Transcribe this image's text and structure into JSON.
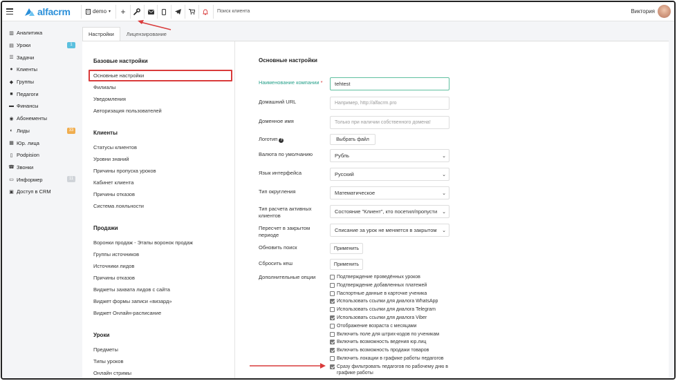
{
  "app": {
    "logo_text": "alfacrm",
    "branch": "demo",
    "search_placeholder": "Поиск клиента",
    "user_name": "Виктория"
  },
  "toolbar_icons": [
    "plus-icon",
    "wrench-icon",
    "mail-icon",
    "phone-icon",
    "telegram-icon",
    "cart-icon",
    "bell-icon"
  ],
  "sidebar": {
    "items": [
      {
        "label": "Аналитика",
        "icon": "analytics-icon"
      },
      {
        "label": "Уроки",
        "icon": "lessons-icon",
        "badge": "1",
        "badge_color": "#5bc0de"
      },
      {
        "label": "Задачи",
        "icon": "tasks-icon"
      },
      {
        "label": "Клиенты",
        "icon": "client-icon"
      },
      {
        "label": "Группы",
        "icon": "groups-icon"
      },
      {
        "label": "Педагоги",
        "icon": "teachers-icon"
      },
      {
        "label": "Финансы",
        "icon": "finance-icon"
      },
      {
        "label": "Абонементы",
        "icon": "subscriptions-icon"
      },
      {
        "label": "Лиды",
        "icon": "leads-icon",
        "badge": "33",
        "badge_color": "#f0ad4e"
      },
      {
        "label": "Юр. лица",
        "icon": "legal-icon"
      },
      {
        "label": "Podpision",
        "icon": "doc-icon"
      },
      {
        "label": "Звонки",
        "icon": "calls-icon"
      },
      {
        "label": "Информер",
        "icon": "informer-icon",
        "badge": "11",
        "badge_color": "#cfd3d8"
      },
      {
        "label": "Доступ в CRM",
        "icon": "lock-icon"
      }
    ]
  },
  "tabs": [
    {
      "label": "Настройки"
    },
    {
      "label": "Лицензирование"
    }
  ],
  "menu": {
    "sections": [
      {
        "title": "Базовые настройки",
        "links": [
          "Основные настройки",
          "Филиалы",
          "Уведомления",
          "Авторизация пользователей"
        ]
      },
      {
        "title": "Клиенты",
        "links": [
          "Статусы клиентов",
          "Уровни знаний",
          "Причины пропуска уроков",
          "Кабинет клиента",
          "Причины отказов",
          "Система лояльности"
        ]
      },
      {
        "title": "Продажи",
        "links": [
          "Воронки продаж - Этапы воронок продаж",
          "Группы источников",
          "Источники лидов",
          "Причины отказов",
          "Виджеты захвата лидов с сайта",
          "Виджет формы записи «визард»",
          "Виджет Онлайн-расписание"
        ]
      },
      {
        "title": "Уроки",
        "links": [
          "Предметы",
          "Типы уроков",
          "Онлайн стримы"
        ]
      }
    ]
  },
  "form": {
    "title": "Основные настройки",
    "company_label": "Наименование компании",
    "company_required": "*",
    "company_value": "tehtest",
    "home_url_label": "Домашний URL",
    "home_url_placeholder": "Например, http://alfacrm.pro",
    "domain_label": "Доменное имя",
    "domain_placeholder": "Только при наличии собственного домена!",
    "logo_label": "Логотип",
    "logo_button": "Выбрать файл",
    "currency_label": "Валюта по умолчанию",
    "currency_value": "Рубль",
    "lang_label": "Язык интерфейса",
    "lang_value": "Русский",
    "rounding_label": "Тип округления",
    "rounding_value": "Математическое",
    "active_label": "Тип расчета активных клиентов",
    "active_value": "Состояние \"Клиент\", кто посетил/пропусти",
    "recalc_label": "Пересчет в закрытом периоде",
    "recalc_value": "Списание за урок не меняется в закрытом",
    "search_update_label": "Обновить поиск",
    "search_update_button": "Применить",
    "cache_label": "Сбросить кеш",
    "cache_button": "Применить",
    "options_label": "Дополнительные опции",
    "options": [
      {
        "label": "Подтверждение проведённых уроков",
        "checked": false
      },
      {
        "label": "Подтверждение добавленных платежей",
        "checked": false
      },
      {
        "label": "Паспортные данные в карточке ученика",
        "checked": false
      },
      {
        "label": "Использовать ссылки для диалога WhatsApp",
        "checked": true
      },
      {
        "label": "Использовать ссылки для диалога Telegram",
        "checked": false
      },
      {
        "label": "Использовать ссылки для диалога Viber",
        "checked": true
      },
      {
        "label": "Отображение возраста с месяцами",
        "checked": false
      },
      {
        "label": "Включить поле для штрих-кодов по ученикам",
        "checked": false
      },
      {
        "label": "Включить возможность ведения юр.лиц",
        "checked": true
      },
      {
        "label": "Включить возможность продажи товаров",
        "checked": true
      },
      {
        "label": "Включить локации в графике работы педагогов",
        "checked": false
      },
      {
        "label": "Сразу фильтровать педагогов по рабочему дню в графике работы",
        "checked": true
      }
    ]
  },
  "colors": {
    "accent": "#26a08a",
    "brand": "#2a8fd9",
    "annotation": "#d93a3a"
  }
}
